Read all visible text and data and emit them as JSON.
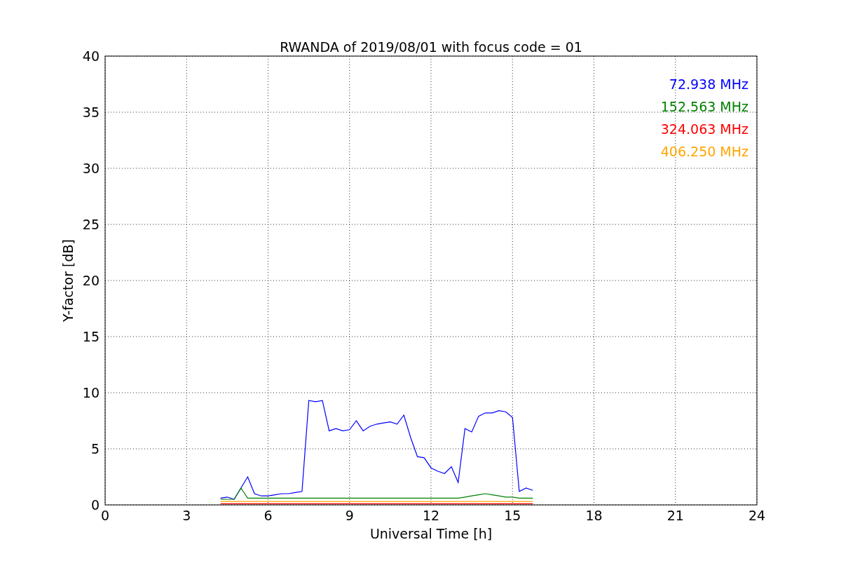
{
  "chart_data": {
    "type": "line",
    "title": "RWANDA of 2019/08/01 with focus code = 01",
    "xlabel": "Universal Time [h]",
    "ylabel": "Y-factor [dB]",
    "x": [
      4.25,
      4.5,
      4.75,
      5.0,
      5.25,
      5.5,
      5.75,
      6.0,
      6.25,
      6.5,
      6.75,
      7.0,
      7.25,
      7.5,
      7.75,
      8.0,
      8.25,
      8.5,
      8.75,
      9.0,
      9.25,
      9.5,
      9.75,
      10.0,
      10.25,
      10.5,
      10.75,
      11.0,
      11.25,
      11.5,
      11.75,
      12.0,
      12.25,
      12.5,
      12.75,
      13.0,
      13.25,
      13.5,
      13.75,
      14.0,
      14.25,
      14.5,
      14.75,
      15.0,
      15.25,
      15.5,
      15.75
    ],
    "series": [
      {
        "name": "72.938 MHz",
        "color": "#0000ff",
        "values": [
          0.6,
          0.7,
          0.5,
          1.5,
          2.5,
          1.0,
          0.8,
          0.8,
          0.9,
          1.0,
          1.0,
          1.1,
          1.2,
          9.3,
          9.2,
          9.3,
          6.6,
          6.8,
          6.6,
          6.7,
          7.5,
          6.6,
          7.0,
          7.2,
          7.3,
          7.4,
          7.2,
          8.0,
          6.0,
          4.3,
          4.2,
          3.3,
          3.0,
          2.8,
          3.4,
          2.0,
          6.8,
          6.5,
          7.9,
          8.2,
          8.2,
          8.4,
          8.3,
          7.8,
          1.2,
          1.5,
          1.3
        ]
      },
      {
        "name": "152.563 MHz",
        "color": "#008000",
        "values": [
          0.5,
          0.5,
          0.5,
          1.5,
          0.6,
          0.6,
          0.6,
          0.6,
          0.6,
          0.6,
          0.6,
          0.6,
          0.6,
          0.6,
          0.6,
          0.6,
          0.6,
          0.6,
          0.6,
          0.6,
          0.6,
          0.6,
          0.6,
          0.6,
          0.6,
          0.6,
          0.6,
          0.6,
          0.6,
          0.6,
          0.6,
          0.6,
          0.6,
          0.6,
          0.6,
          0.6,
          0.7,
          0.8,
          0.9,
          1.0,
          0.9,
          0.8,
          0.7,
          0.7,
          0.6,
          0.6,
          0.6
        ]
      },
      {
        "name": "324.063 MHz",
        "color": "#ff0000",
        "values": [
          0.1,
          0.1,
          0.1,
          0.1,
          0.1,
          0.1,
          0.1,
          0.1,
          0.1,
          0.1,
          0.1,
          0.1,
          0.1,
          0.1,
          0.1,
          0.1,
          0.1,
          0.1,
          0.1,
          0.1,
          0.1,
          0.1,
          0.1,
          0.1,
          0.1,
          0.1,
          0.1,
          0.1,
          0.1,
          0.1,
          0.1,
          0.1,
          0.1,
          0.1,
          0.1,
          0.1,
          0.1,
          0.1,
          0.1,
          0.1,
          0.1,
          0.1,
          0.1,
          0.1,
          0.1,
          0.1,
          0.1
        ]
      },
      {
        "name": "406.250 MHz",
        "color": "#ffa500",
        "values": [
          0.3,
          0.3,
          0.3,
          0.3,
          0.3,
          0.3,
          0.3,
          0.3,
          0.3,
          0.3,
          0.3,
          0.3,
          0.3,
          0.3,
          0.3,
          0.3,
          0.3,
          0.3,
          0.3,
          0.3,
          0.3,
          0.3,
          0.3,
          0.3,
          0.3,
          0.3,
          0.3,
          0.3,
          0.3,
          0.3,
          0.3,
          0.3,
          0.3,
          0.3,
          0.3,
          0.3,
          0.3,
          0.3,
          0.3,
          0.3,
          0.3,
          0.3,
          0.3,
          0.3,
          0.3,
          0.3,
          0.3
        ]
      }
    ],
    "xlim": [
      0,
      24
    ],
    "ylim": [
      0,
      40
    ],
    "xticks": [
      0,
      3,
      6,
      9,
      12,
      15,
      18,
      21,
      24
    ],
    "yticks": [
      0,
      5,
      10,
      15,
      20,
      25,
      30,
      35,
      40
    ],
    "grid": true
  }
}
